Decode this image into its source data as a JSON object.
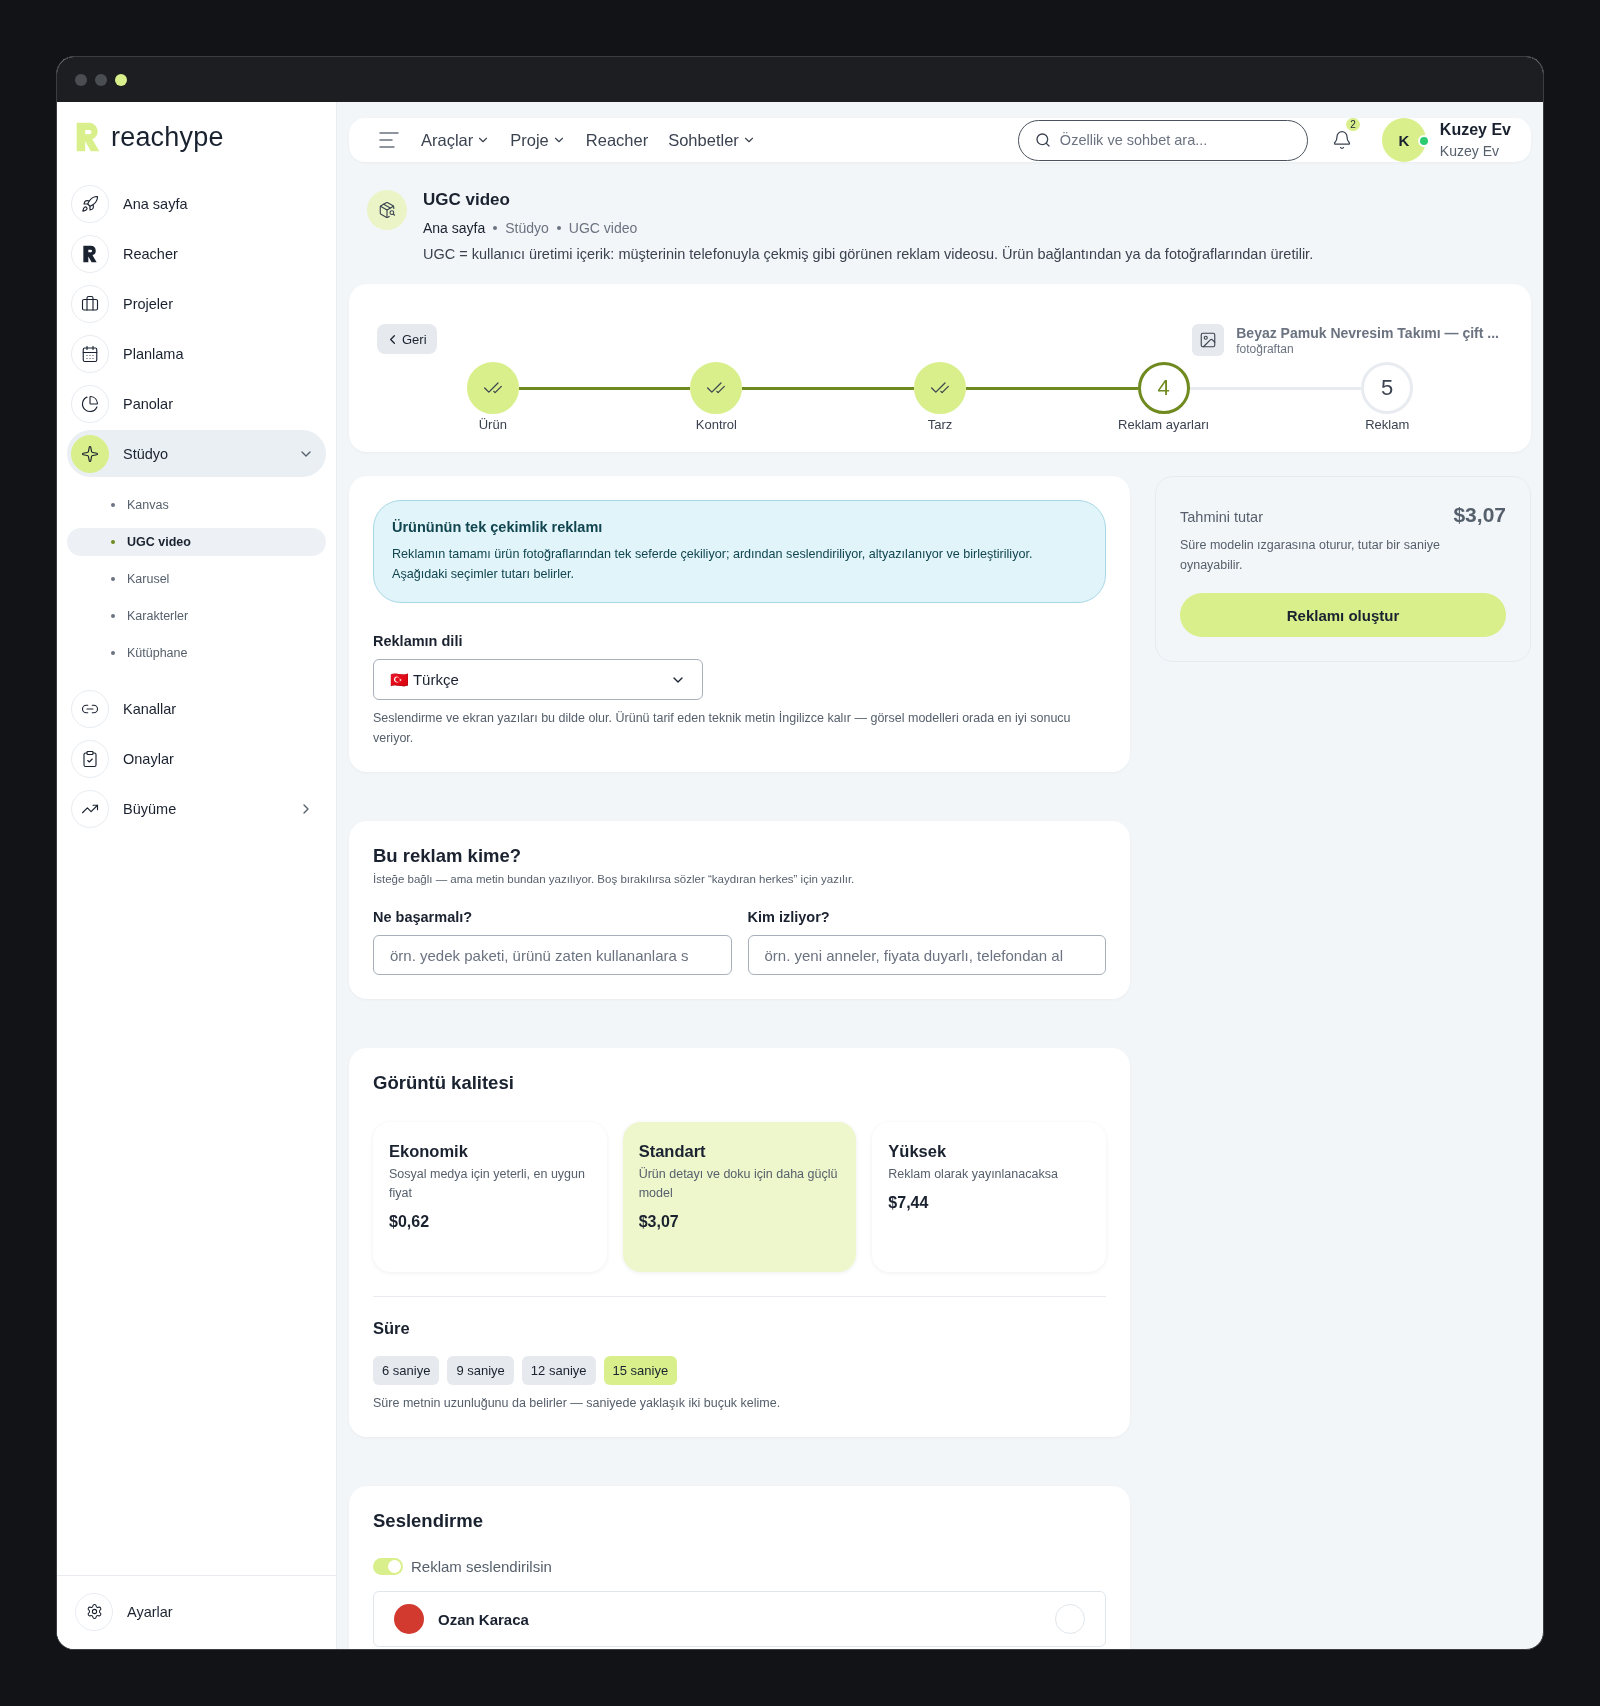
{
  "brand": {
    "name": "reachype"
  },
  "sidebar": {
    "items": [
      {
        "label": "Ana sayfa",
        "kind": "link",
        "selected": false
      },
      {
        "label": "Reacher",
        "kind": "link",
        "selected": false
      },
      {
        "label": "Projeler",
        "kind": "link",
        "selected": false
      },
      {
        "label": "Planlama",
        "kind": "link",
        "selected": false
      },
      {
        "label": "Panolar",
        "kind": "link",
        "selected": false
      },
      {
        "label": "Stüdyo",
        "kind": "group",
        "selected": true,
        "expanded": true,
        "children": [
          {
            "label": "Kanvas",
            "selected": false
          },
          {
            "label": "UGC video",
            "selected": true
          },
          {
            "label": "Karusel",
            "selected": false
          },
          {
            "label": "Karakterler",
            "selected": false
          },
          {
            "label": "Kütüphane",
            "selected": false
          }
        ]
      },
      {
        "label": "Kanallar",
        "kind": "link",
        "selected": false
      },
      {
        "label": "Onaylar",
        "kind": "link",
        "selected": false
      },
      {
        "label": "Büyüme",
        "kind": "group",
        "selected": false,
        "expanded": false
      }
    ],
    "footer": {
      "label": "Ayarlar"
    }
  },
  "topnav": {
    "menu": [
      {
        "label": "Araçlar",
        "dropdown": true
      },
      {
        "label": "Proje",
        "dropdown": true
      },
      {
        "label": "Reacher",
        "dropdown": false
      },
      {
        "label": "Sohbetler",
        "dropdown": true
      }
    ],
    "search": {
      "placeholder": "Özellik ve sohbet ara..."
    },
    "notifications": {
      "count": "2"
    },
    "user": {
      "initial": "K",
      "name": "Kuzey Ev",
      "subtitle": "Kuzey Ev",
      "online": true
    }
  },
  "page": {
    "title": "UGC video",
    "breadcrumb": [
      "Ana sayfa",
      "Stüdyo",
      "UGC video"
    ],
    "description": "UGC = kullanıcı üretimi içerik: müşterinin telefonuyla çekmiş gibi görünen reklam videosu. Ürün bağlantından ya da fotoğraflarından üretilir."
  },
  "wizard": {
    "back": "Geri",
    "product": {
      "name": "Beyaz Pamuk Nevresim Takımı — çift ...",
      "source": "fotoğraftan"
    },
    "steps": [
      {
        "label": "Ürün",
        "done": true,
        "current": false
      },
      {
        "label": "Kontrol",
        "done": true,
        "current": false
      },
      {
        "label": "Tarz",
        "done": true,
        "current": false
      },
      {
        "label": "Reklam ayarları",
        "number": "4",
        "done": false,
        "current": true
      },
      {
        "label": "Reklam",
        "number": "5",
        "done": false,
        "current": false
      }
    ]
  },
  "info": {
    "title": "Ürününün tek çekimlik reklamı",
    "text": "Reklamın tamamı ürün fotoğraflarından tek seferde çekiliyor; ardından seslendiriliyor, altyazılanıyor ve birleştiriliyor. Aşağıdaki seçimler tutarı belirler."
  },
  "language": {
    "label": "Reklamın dili",
    "value": "🇹🇷 Türkçe",
    "hint": "Seslendirme ve ekran yazıları bu dilde olur. Ürünü tarif eden teknik metin İngilizce kalır — görsel modelleri orada en iyi sonucu veriyor."
  },
  "audience": {
    "title": "Bu reklam kime?",
    "subtitle": "İsteğe bağlı — ama metin bundan yazılıyor. Boş bırakılırsa sözler “kaydıran herkes” için yazılır.",
    "fields": [
      {
        "label": "Ne başarmalı?",
        "placeholder": "örn. yedek paketi, ürünü zaten kullananlara s"
      },
      {
        "label": "Kim izliyor?",
        "placeholder": "örn. yeni anneler, fiyata duyarlı, telefondan al"
      }
    ]
  },
  "quality": {
    "title": "Görüntü kalitesi",
    "options": [
      {
        "name": "Ekonomik",
        "description": "Sosyal medya için yeterli, en uygun fiyat",
        "price": "$0,62",
        "selected": false
      },
      {
        "name": "Standart",
        "description": "Ürün detayı ve doku için daha güçlü model",
        "price": "$3,07",
        "selected": true
      },
      {
        "name": "Yüksek",
        "description": "Reklam olarak yayınlanacaksa",
        "price": "$7,44",
        "selected": false
      }
    ]
  },
  "duration": {
    "title": "Süre",
    "options": [
      {
        "label": "6 saniye",
        "selected": false
      },
      {
        "label": "9 saniye",
        "selected": false
      },
      {
        "label": "12 saniye",
        "selected": false
      },
      {
        "label": "15 saniye",
        "selected": true
      }
    ],
    "hint": "Süre metnin uzunluğunu da belirler — saniyede yaklaşık iki buçuk kelime."
  },
  "voice": {
    "title": "Seslendirme",
    "toggle": {
      "label": "Reklam seslendirilsin",
      "on": true
    },
    "voices": [
      {
        "name": "Ozan Karaca"
      }
    ]
  },
  "estimate": {
    "label": "Tahmini tutar",
    "amount": "$3,07",
    "note": "Süre modelin ızgarasına oturur, tutar bir saniye oynayabilir.",
    "button": "Reklamı oluştur"
  }
}
